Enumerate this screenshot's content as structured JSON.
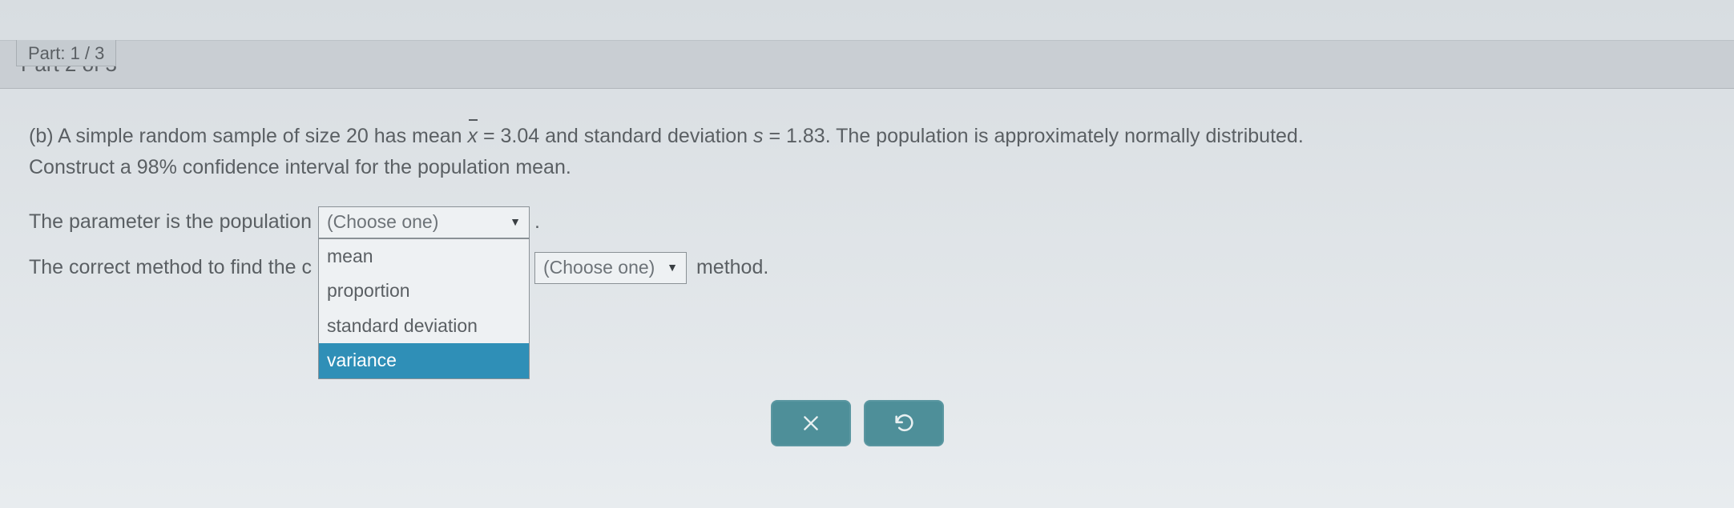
{
  "topBar": {
    "label": "Part: 1 / 3"
  },
  "sectionHeader": {
    "label": "Part 2 of 3"
  },
  "question": {
    "prefix": "(b) A simple random sample of size ",
    "n": "20",
    "t1": " has mean ",
    "xbar": "x",
    "eq1": " = ",
    "mean": "3.04",
    "t2": " and standard deviation ",
    "svar": "s",
    "eq2": " = ",
    "sd": "1.83",
    "t3": ". The population is approximately normally distributed.",
    "line2a": "Construct a ",
    "confLevel": "98%",
    "line2b": " confidence interval for the population mean."
  },
  "line1": {
    "text": "The parameter is the population ",
    "select": {
      "placeholder": "(Choose one)",
      "options": [
        "mean",
        "proportion",
        "standard deviation",
        "variance"
      ],
      "highlighted": "variance"
    },
    "after": "."
  },
  "line2": {
    "textA": "The correct method to find the c",
    "select": {
      "placeholder": "(Choose one)"
    },
    "textB": "method."
  },
  "buttons": {
    "clear": "clear",
    "reset": "reset"
  }
}
